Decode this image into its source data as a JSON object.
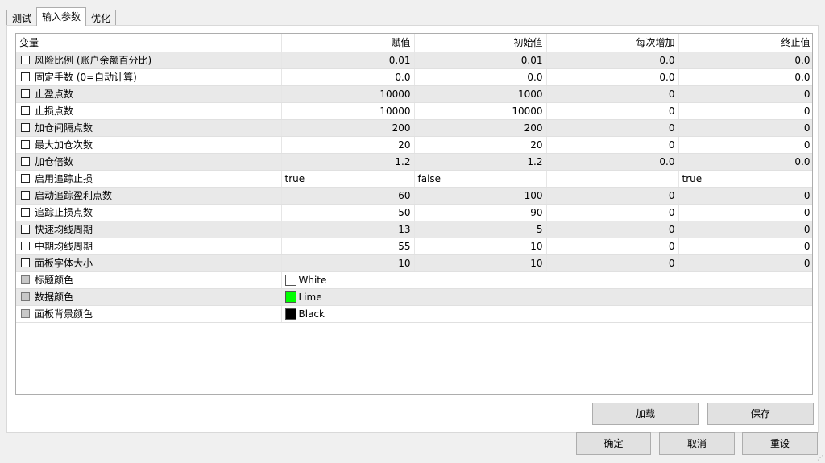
{
  "tabs": [
    "测试",
    "输入参数",
    "优化"
  ],
  "active_tab": 1,
  "columns": [
    "变量",
    "赋值",
    "初始值",
    "每次增加",
    "终止值"
  ],
  "rows": [
    {
      "name": "风险比例 (账户余额百分比)",
      "value": "0.01",
      "start": "0.01",
      "step": "0.0",
      "stop": "0.0"
    },
    {
      "name": "固定手数 (0=自动计算)",
      "value": "0.0",
      "start": "0.0",
      "step": "0.0",
      "stop": "0.0"
    },
    {
      "name": "止盈点数",
      "value": "10000",
      "start": "1000",
      "step": "0",
      "stop": "0"
    },
    {
      "name": "止损点数",
      "value": "10000",
      "start": "10000",
      "step": "0",
      "stop": "0"
    },
    {
      "name": "加仓间隔点数",
      "value": "200",
      "start": "200",
      "step": "0",
      "stop": "0"
    },
    {
      "name": "最大加仓次数",
      "value": "20",
      "start": "20",
      "step": "0",
      "stop": "0"
    },
    {
      "name": "加仓倍数",
      "value": "1.2",
      "start": "1.2",
      "step": "0.0",
      "stop": "0.0"
    },
    {
      "name": "启用追踪止损",
      "value": "true",
      "start": "false",
      "step": "",
      "stop": "true",
      "bool": true
    },
    {
      "name": "启动追踪盈利点数",
      "value": "60",
      "start": "100",
      "step": "0",
      "stop": "0"
    },
    {
      "name": "追踪止损点数",
      "value": "50",
      "start": "90",
      "step": "0",
      "stop": "0"
    },
    {
      "name": "快速均线周期",
      "value": "13",
      "start": "5",
      "step": "0",
      "stop": "0"
    },
    {
      "name": "中期均线周期",
      "value": "55",
      "start": "10",
      "step": "0",
      "stop": "0"
    },
    {
      "name": "面板字体大小",
      "value": "10",
      "start": "10",
      "step": "0",
      "stop": "0"
    },
    {
      "name": "标题颜色",
      "value": "White",
      "color": "#ffffff"
    },
    {
      "name": "数据颜色",
      "value": "Lime",
      "color": "#00ff00"
    },
    {
      "name": "面板背景颜色",
      "value": "Black",
      "color": "#000000"
    }
  ],
  "buttons": {
    "load": "加载",
    "save": "保存",
    "ok": "确定",
    "cancel": "取消",
    "reset": "重设"
  }
}
